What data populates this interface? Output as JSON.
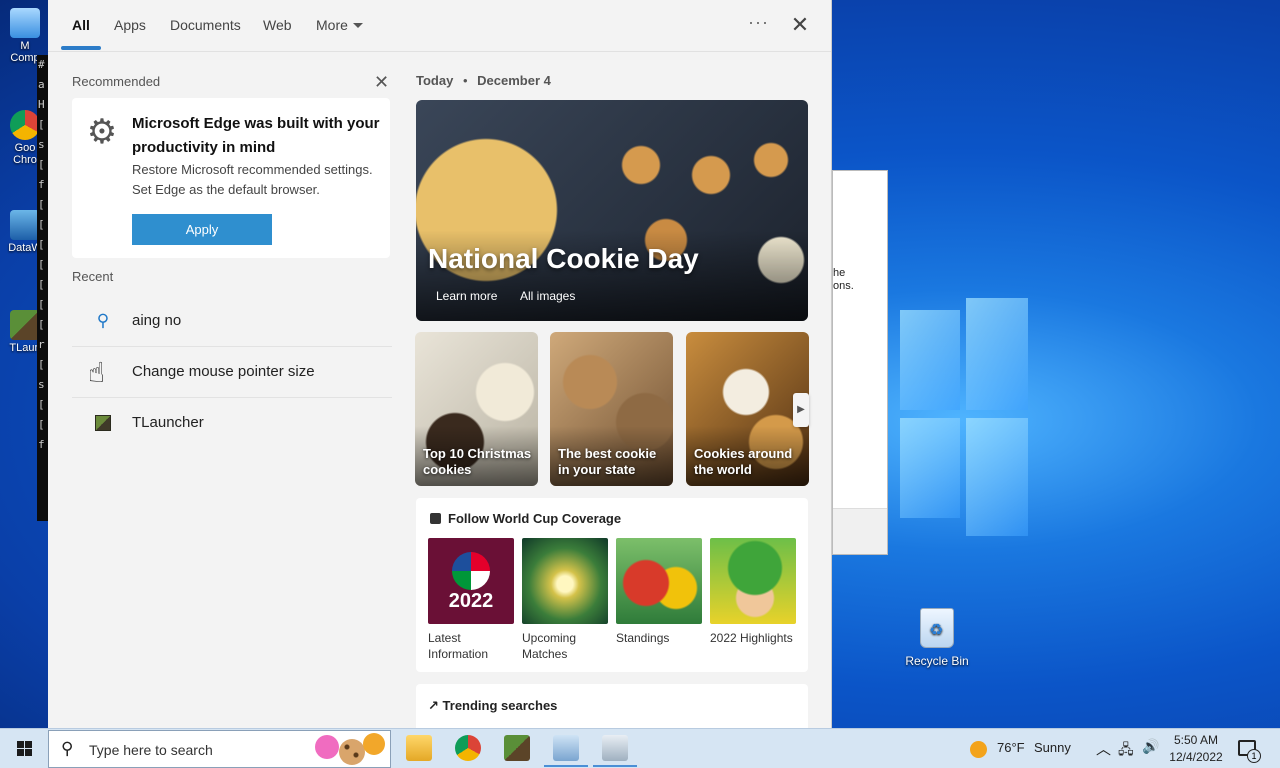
{
  "desktop": {
    "icons": [
      {
        "label": "M",
        "sublabel": "Comp",
        "icon": "this-pc-icon"
      },
      {
        "label": "Goo",
        "sublabel": "Chro",
        "icon": "chrome-icon"
      },
      {
        "label": "DataW",
        "sublabel": "",
        "icon": "datawrapper-icon"
      },
      {
        "label": "TLaun",
        "sublabel": "",
        "icon": "tlauncher-icon"
      }
    ],
    "console_lines": [
      "#",
      "a",
      "H",
      "[",
      "s",
      "[",
      "f",
      "[",
      "[",
      "[",
      "[",
      "[",
      "[",
      "[",
      "r",
      "[",
      "s",
      "[",
      "[",
      "f"
    ],
    "dialog_text": "he\nons.",
    "recycle_bin": "Recycle Bin"
  },
  "search_panel": {
    "tabs": [
      {
        "label": "All",
        "active": true
      },
      {
        "label": "Apps",
        "active": false
      },
      {
        "label": "Documents",
        "active": false
      },
      {
        "label": "Web",
        "active": false
      },
      {
        "label": "More",
        "active": false
      }
    ],
    "more_options": "···",
    "close": "✕",
    "recommended": {
      "heading": "Recommended",
      "title": "Microsoft Edge was built with your productivity in mind",
      "description": "Restore Microsoft recommended settings. Set Edge as the default browser.",
      "button": "Apply",
      "dismiss": "✕"
    },
    "recent": {
      "heading": "Recent",
      "items": [
        {
          "label": "aing no",
          "icon": "search-icon"
        },
        {
          "label": "Change mouse pointer size",
          "icon": "mouse-pointer-icon"
        },
        {
          "label": "TLauncher",
          "icon": "tlauncher-icon"
        }
      ]
    },
    "today": {
      "label": "Today",
      "separator": "•",
      "date": "December 4"
    },
    "hero": {
      "title": "National Cookie Day",
      "links": [
        "Learn more",
        "All images"
      ]
    },
    "cards": [
      {
        "caption": "Top 10 Christmas cookies"
      },
      {
        "caption": "The best cookie in your state"
      },
      {
        "caption": "Cookies around the world"
      }
    ],
    "world_cup": {
      "title": "Follow World Cup Coverage",
      "tiles": [
        {
          "caption": "Latest Information",
          "overlay": "2022"
        },
        {
          "caption": "Upcoming Matches"
        },
        {
          "caption": "Standings"
        },
        {
          "caption": "2022 Highlights"
        }
      ]
    },
    "trending": {
      "title": "Trending searches"
    }
  },
  "taskbar": {
    "search_placeholder": "Type here to search",
    "apps": [
      "file-explorer-icon",
      "chrome-icon",
      "minecraft-icon",
      "app-icon",
      "image-viewer-icon"
    ],
    "weather": {
      "temp": "76°F",
      "condition": "Sunny"
    },
    "clock": {
      "time": "5:50 AM",
      "date": "12/4/2022"
    },
    "notification_count": "1"
  },
  "colors": {
    "accent": "#2f8fcf",
    "tab_underline": "#2c7cc8",
    "panel_bg": "#f3f3f3",
    "taskbar_bg": "#d6e5f3"
  }
}
